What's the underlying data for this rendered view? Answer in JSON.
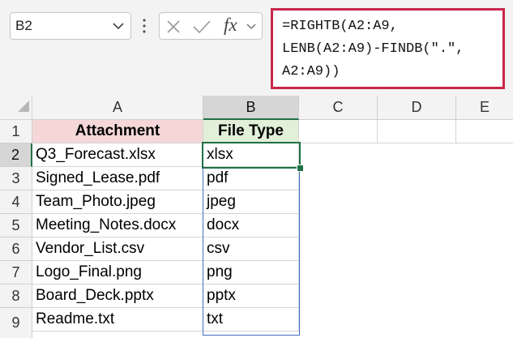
{
  "name_box": {
    "value": "B2"
  },
  "formula_bar": {
    "lines": [
      "=RIGHTB(A2:A9,",
      "LENB(A2:A9)-FINDB(\".\",",
      "A2:A9))"
    ]
  },
  "fx_label": "fx",
  "columns": [
    "A",
    "B",
    "C",
    "D",
    "E"
  ],
  "rows": [
    "1",
    "2",
    "3",
    "4",
    "5",
    "6",
    "7",
    "8",
    "9"
  ],
  "table": {
    "headers": [
      "Attachment",
      "File Type"
    ],
    "rows": [
      [
        "Q3_Forecast.xlsx",
        "xlsx"
      ],
      [
        "Signed_Lease.pdf",
        "pdf"
      ],
      [
        "Team_Photo.jpeg",
        "jpeg"
      ],
      [
        "Meeting_Notes.docx",
        "docx"
      ],
      [
        "Vendor_List.csv",
        "csv"
      ],
      [
        "Logo_Final.png",
        "png"
      ],
      [
        "Board_Deck.pptx",
        "pptx"
      ],
      [
        "Readme.txt",
        "txt"
      ]
    ]
  },
  "colors": {
    "attachment_header_fill": "#f5d7d7",
    "filetype_header_fill": "#e2efd9",
    "formula_highlight": "#c8264c",
    "selection": "#1e7145",
    "spill_border": "#4472c4"
  }
}
